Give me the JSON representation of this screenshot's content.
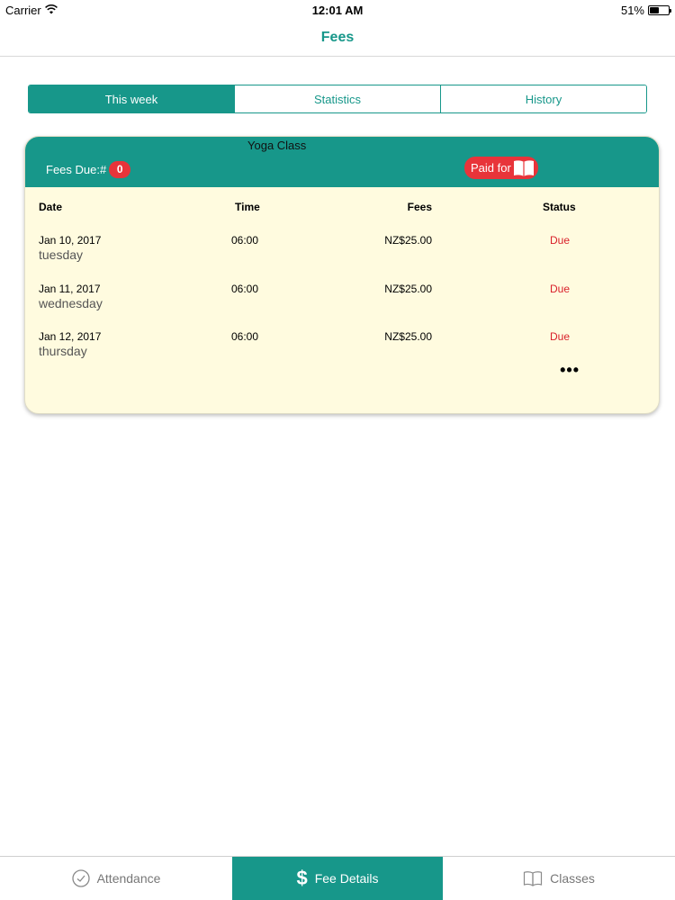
{
  "status_bar": {
    "carrier": "Carrier",
    "time": "12:01 AM",
    "battery_percent": "51%",
    "battery_level": 0.51
  },
  "nav": {
    "title": "Fees"
  },
  "segments": [
    {
      "label": "This week",
      "active": true
    },
    {
      "label": "Statistics",
      "active": false
    },
    {
      "label": "History",
      "active": false
    }
  ],
  "card": {
    "title": "Yoga Class",
    "fees_due_label": "Fees Due:#",
    "fees_due_count": "0",
    "paid_for_label": "Paid for",
    "paid_for_icon": "book-open-icon",
    "columns": {
      "date": "Date",
      "time": "Time",
      "fees": "Fees",
      "status": "Status"
    },
    "rows": [
      {
        "date": "Jan 10, 2017",
        "day": "tuesday",
        "time": "06:00",
        "fee": "NZ$25.00",
        "status": "Due"
      },
      {
        "date": "Jan 11, 2017",
        "day": "wednesday",
        "time": "06:00",
        "fee": "NZ$25.00",
        "status": "Due"
      },
      {
        "date": "Jan 12, 2017",
        "day": "thursday",
        "time": "06:00",
        "fee": "NZ$25.00",
        "status": "Due"
      }
    ],
    "more": "•••"
  },
  "tab_bar": [
    {
      "label": "Attendance",
      "icon": "check-circle-icon",
      "active": false
    },
    {
      "label": "Fee Details",
      "icon": "dollar-icon",
      "icon_glyph": "$",
      "active": true
    },
    {
      "label": "Classes",
      "icon": "book-icon",
      "active": false
    }
  ],
  "colors": {
    "accent": "#17978a",
    "alert": "#e8343a",
    "card_bg": "#fffbdf",
    "due_text": "#d9202a"
  }
}
